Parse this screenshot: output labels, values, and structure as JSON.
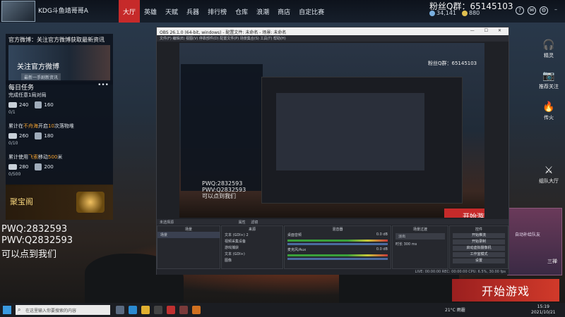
{
  "game": {
    "player_name": "KDG斗鱼靖哥哥A",
    "nav": [
      "大厅",
      "英雄",
      "天赋",
      "兵器",
      "排行榜",
      "仓库",
      "浪潮",
      "商店",
      "自定比赛"
    ],
    "active_nav": "大厅",
    "fans": "粉丝Q群：65145103",
    "coins": [
      "34,141",
      "880"
    ],
    "top_icons": [
      "question-icon",
      "mail-icon",
      "settings-icon",
      "minimize-icon",
      "close-icon"
    ]
  },
  "left_panel": {
    "weibo_title": "官方微博：关注官方微博获取最新资讯",
    "weibo_banner": "关注官方微博",
    "weibo_sub": "最新一手剧新资讯",
    "tasks_title": "每日任务",
    "tasks": [
      {
        "name": "完成任意1局对局",
        "highlight": "",
        "rewards": [
          "240",
          "160"
        ],
        "progress": "0/1"
      },
      {
        "name_a": "累计在",
        "highlight": "不舟海",
        "name_b": "开启",
        "highlight2": "10",
        "name_c": "次落物堆",
        "rewards": [
          "260",
          "180"
        ],
        "progress": "0/10"
      },
      {
        "name_a": "累计使用",
        "highlight": "飞索",
        "name_b": "移动",
        "highlight2": "500",
        "name_c": "米",
        "rewards": [
          "280",
          "200"
        ],
        "progress": "0/500"
      }
    ],
    "treasure_label": "聚宝阁"
  },
  "stream_text": [
    "PWQ:2832593",
    "PWV:Q2832593",
    "可以点到我们"
  ],
  "right_sidebar": [
    {
      "icon": "headset-icon",
      "label": "精灵"
    },
    {
      "icon": "camera-icon",
      "label": "推荐关注"
    },
    {
      "icon": "flame-icon",
      "label": "传火"
    },
    {
      "icon": "team-icon",
      "label": "组队大厅"
    }
  ],
  "promo": {
    "text": "自动补给队友",
    "text2": "三禅"
  },
  "start_button": "开始游戏",
  "obs": {
    "title": "OBS 26.1.0 (64-bit, windows) - 配置文件: 未命名 - 场景: 未命名",
    "menu": "文件(F)  编辑(E)  视图(V)  停靠部件(D)  配置文件(P)  场景集合(S)  工具(T)  帮助(H)",
    "preview_fans": "粉丝Q群：65145103",
    "preview_start": "开始游戏",
    "bar_left": "未选择源",
    "bar_mid": "属性",
    "bar_mid2": "滤镜",
    "docks": {
      "scenes": {
        "title": "场景",
        "item": "场景"
      },
      "sources": {
        "title": "来源",
        "items": [
          "文本 (GDI+) 2",
          "视频采集设备",
          "游戏捕获",
          "文本 (GDI+)",
          "图像",
          "水印",
          "显示器捕获"
        ]
      },
      "mixer": {
        "title": "混音器",
        "ch1": "桌面音频",
        "ch2": "麦克风/Aux",
        "db1": "0.0 dB",
        "db2": "0.0 dB"
      },
      "transitions": {
        "title": "场景过渡",
        "mode": "淡出",
        "dur_label": "时长",
        "duration": "300 ms"
      },
      "controls": {
        "title": "控件",
        "buttons": [
          "开始推流",
          "开始录制",
          "启动虚拟摄像机",
          "工作室模式",
          "设置",
          "退出"
        ]
      }
    },
    "status": "LIVE: 00:00:00   REC: 00:00:00   CPU: 6.5%, 30.00 fps"
  },
  "taskbar": {
    "search_placeholder": "在这里输入你要搜索的内容",
    "weather": "21°C 雨霾",
    "time": "15:19",
    "date": "2021/10/21"
  }
}
